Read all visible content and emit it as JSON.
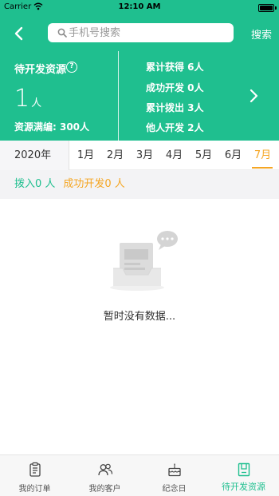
{
  "status_bar": {
    "carrier": "Carrier",
    "time": "12:10 AM"
  },
  "nav": {
    "search_placeholder": "手机号搜索",
    "search_button": "搜索"
  },
  "summary": {
    "pending_title": "待开发资源",
    "pending_count": "1",
    "pending_unit": "人",
    "full_label": "资源满编: 300人",
    "stats": [
      "累计获得 6人",
      "成功开发 0人",
      "累计拨出 3人",
      "他人开发 2人"
    ]
  },
  "months": {
    "year": "2020年",
    "tabs": [
      "1月",
      "2月",
      "3月",
      "4月",
      "5月",
      "6月",
      "7月"
    ],
    "active_index": 6
  },
  "info": {
    "dial_in": "拨入0 人",
    "success": "成功开发0 人"
  },
  "empty": {
    "text": "暂时没有数据..."
  },
  "tabbar": {
    "items": [
      {
        "label": "我的订单",
        "icon": "clipboard-icon"
      },
      {
        "label": "我的客户",
        "icon": "users-icon"
      },
      {
        "label": "纪念日",
        "icon": "cake-icon"
      },
      {
        "label": "待开发资源",
        "icon": "resource-box-icon"
      }
    ],
    "active_index": 3
  },
  "colors": {
    "primary": "#1fbf8f",
    "accent": "#f5a623"
  }
}
